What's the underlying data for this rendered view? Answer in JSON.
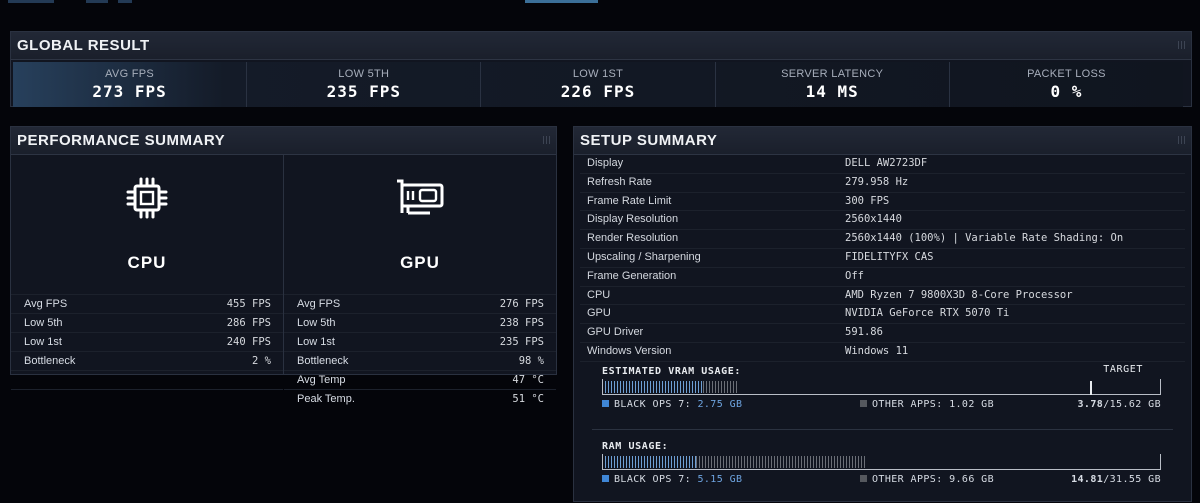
{
  "global": {
    "title": "GLOBAL RESULT",
    "stats": [
      {
        "label": "AVG FPS",
        "value": "273 FPS"
      },
      {
        "label": "LOW 5TH",
        "value": "235 FPS"
      },
      {
        "label": "LOW 1ST",
        "value": "226 FPS"
      },
      {
        "label": "SERVER LATENCY",
        "value": "14 MS"
      },
      {
        "label": "PACKET LOSS",
        "value": "0 %"
      }
    ]
  },
  "performance": {
    "title": "PERFORMANCE SUMMARY",
    "cpu": {
      "title": "CPU",
      "icon": "cpu-icon",
      "rows": [
        {
          "label": "Avg FPS",
          "value": "455 FPS"
        },
        {
          "label": "Low 5th",
          "value": "286 FPS"
        },
        {
          "label": "Low 1st",
          "value": "240 FPS"
        },
        {
          "label": "Bottleneck",
          "value": "2 %"
        }
      ]
    },
    "gpu": {
      "title": "GPU",
      "icon": "gpu-icon",
      "rows": [
        {
          "label": "Avg FPS",
          "value": "276 FPS"
        },
        {
          "label": "Low 5th",
          "value": "238 FPS"
        },
        {
          "label": "Low 1st",
          "value": "235 FPS"
        },
        {
          "label": "Bottleneck",
          "value": "98 %"
        },
        {
          "label": "Avg Temp",
          "value": "47 °C"
        },
        {
          "label": "Peak Temp.",
          "value": "51 °C"
        }
      ]
    }
  },
  "setup": {
    "title": "SETUP SUMMARY",
    "rows": [
      {
        "label": "Display",
        "value": "DELL AW2723DF"
      },
      {
        "label": "Refresh Rate",
        "value": "279.958 Hz"
      },
      {
        "label": "Frame Rate Limit",
        "value": "300 FPS"
      },
      {
        "label": "Display Resolution",
        "value": "2560x1440"
      },
      {
        "label": "Render Resolution",
        "value": "2560x1440 (100%) | Variable Rate Shading: On"
      },
      {
        "label": "Upscaling / Sharpening",
        "value": "FIDELITYFX CAS"
      },
      {
        "label": "Frame Generation",
        "value": "Off"
      },
      {
        "label": "CPU",
        "value": "AMD Ryzen 7 9800X3D 8-Core Processor"
      },
      {
        "label": "GPU",
        "value": "NVIDIA GeForce RTX 5070 Ti"
      },
      {
        "label": "GPU Driver",
        "value": "591.86"
      },
      {
        "label": "Windows Version",
        "value": "Windows 11"
      }
    ],
    "vram": {
      "label": "ESTIMATED VRAM USAGE:",
      "target_label": "TARGET",
      "game_label": "BLACK OPS 7:",
      "game_value": "2.75 GB",
      "other_label": "OTHER APPS:",
      "other_value": "1.02 GB",
      "total_used": "3.78",
      "total_rest": "/15.62 GB",
      "game_gb": 2.75,
      "other_gb": 1.02,
      "capacity_gb": 15.62,
      "target_fraction": 0.88
    },
    "ram": {
      "label": "RAM USAGE:",
      "game_label": "BLACK OPS 7:",
      "game_value": "5.15 GB",
      "other_label": "OTHER APPS:",
      "other_value": "9.66 GB",
      "total_used": "14.81",
      "total_rest": "/31.55 GB",
      "game_gb": 5.15,
      "other_gb": 9.66,
      "capacity_gb": 31.55
    },
    "colors": {
      "game": "#3f86d6",
      "other": "#55585e"
    }
  }
}
